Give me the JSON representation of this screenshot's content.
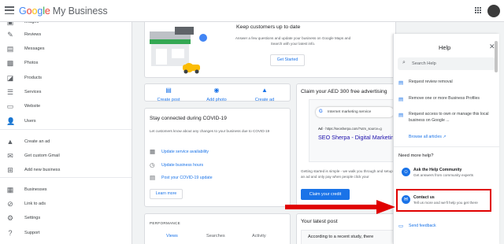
{
  "header": {
    "logo_google": "Google",
    "logo_product": "My Business"
  },
  "sidebar": {
    "items": [
      {
        "label": "Images",
        "icon": "image-icon"
      },
      {
        "label": "Reviews",
        "icon": "reviews-icon"
      },
      {
        "label": "Messages",
        "icon": "messages-icon"
      },
      {
        "label": "Photos",
        "icon": "photos-icon"
      },
      {
        "label": "Products",
        "icon": "products-icon"
      },
      {
        "label": "Services",
        "icon": "services-icon"
      },
      {
        "label": "Website",
        "icon": "website-icon"
      },
      {
        "label": "Users",
        "icon": "users-icon"
      },
      {
        "label": "Create an ad",
        "icon": "ads-icon"
      },
      {
        "label": "Get custom Gmail",
        "icon": "gmail-icon"
      },
      {
        "label": "Add new business",
        "icon": "add-business-icon"
      },
      {
        "label": "Businesses",
        "icon": "businesses-icon"
      },
      {
        "label": "Link to ads",
        "icon": "link-icon"
      },
      {
        "label": "Settings",
        "icon": "settings-icon"
      },
      {
        "label": "Support",
        "icon": "support-icon"
      }
    ]
  },
  "hero": {
    "title": "Keep customers up to date",
    "subtitle": "Answer a few questions and update your business on Google Maps and Search with your latest info.",
    "button": "Get Started"
  },
  "quick_actions": [
    {
      "label": "Create post",
      "icon": "post-icon"
    },
    {
      "label": "Add photo",
      "icon": "camera-icon"
    },
    {
      "label": "Create ad",
      "icon": "ads-icon"
    }
  ],
  "covid": {
    "title": "Stay connected during COVID-19",
    "text": "Let customers know about any changes to your business due to COVID-19",
    "links": [
      {
        "label": "Update service availability",
        "icon": "calendar-icon"
      },
      {
        "label": "Update business hours",
        "icon": "clock-icon"
      },
      {
        "label": "Post your COVID-19 update",
        "icon": "post-icon"
      }
    ],
    "learn_more": "Learn more"
  },
  "performance": {
    "label": "PERFORMANCE",
    "tabs": [
      "Views",
      "Searches",
      "Activity"
    ]
  },
  "claim": {
    "title": "Claim your AED 300 free advertising",
    "search_query": "Internet marketing service",
    "ad_label": "Ad",
    "ad_url": "· https://seosherpa.com/?utm_source=g",
    "ad_headline": "SEO Sherpa - Digital Marketing",
    "text": "Getting started is simple - we walk you through and setup an ad and only pay when people click your",
    "button": "Claim your credit"
  },
  "latest_post": {
    "title": "Your latest post",
    "text": "According to a recent study, there"
  },
  "help": {
    "title": "Help",
    "search_placeholder": "Search Help",
    "articles": [
      "Request review removal",
      "Remove one or more Business Profiles",
      "Request access to own or manage this local business on Google ..."
    ],
    "browse_all": "Browse all articles",
    "need_more": "Need more help?",
    "options": [
      {
        "title": "Ask the Help Community",
        "subtitle": "Get answers from community experts",
        "icon": "community-icon"
      },
      {
        "title": "Contact us",
        "subtitle": "Tell us more and we'll help you get there",
        "icon": "contact-icon"
      }
    ],
    "send_feedback": "Send feedback"
  },
  "annotation": {
    "highlight_color": "#e00000"
  }
}
